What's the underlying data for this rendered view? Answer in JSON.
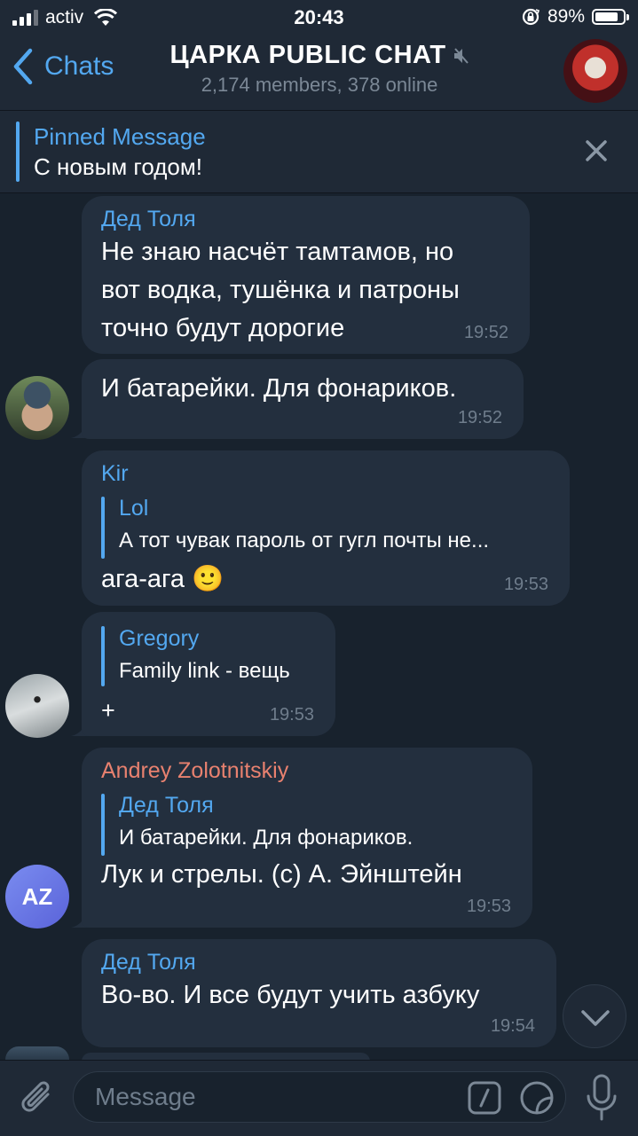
{
  "status_bar": {
    "carrier": "activ",
    "time": "20:43",
    "battery_text": "89%",
    "battery_level": 0.89
  },
  "header": {
    "back_label": "Chats",
    "title": "ЦАРКА PUBLIC CHAT",
    "subtitle": "2,174 members, 378 online",
    "muted": true
  },
  "pinned": {
    "title": "Pinned Message",
    "text": "С новым годом!"
  },
  "messages": [
    {
      "sender": "Дед Толя",
      "sender_color": "#53a8f0",
      "lines": [
        "Не знаю насчёт тамтамов, но",
        "вот водка, тушёнка и патроны",
        "точно будут дорогие"
      ],
      "time": "19:52"
    },
    {
      "lines": [
        "И батарейки. Для фонариков."
      ],
      "time": "19:52"
    },
    {
      "sender": "Kir",
      "sender_color": "#53a8f0",
      "reply": {
        "name": "Lol",
        "text": "А тот чувак пароль от гугл почты не..."
      },
      "lines": [
        "ага-ага 🙂"
      ],
      "time": "19:53"
    },
    {
      "reply": {
        "name": "Gregory",
        "text": "Family link - вещь"
      },
      "lines": [
        "+"
      ],
      "time": "19:53"
    },
    {
      "sender": "Andrey Zolotnitskiy",
      "sender_color": "#e8816f",
      "avatar_initials": "AZ",
      "reply": {
        "name": "Дед Толя",
        "text": "И батарейки. Для фонариков."
      },
      "lines": [
        "Лук и стрелы. (с) А. Эйнштейн"
      ],
      "time": "19:53"
    },
    {
      "sender": "Дед Толя",
      "sender_color": "#53a8f0",
      "lines": [
        "Во-во. И все будут учить азбуку"
      ],
      "time": "19:54"
    }
  ],
  "composer": {
    "placeholder": "Message"
  },
  "colors": {
    "accent": "#53a8f0",
    "background": "#18222d",
    "bubble": "#232f3e",
    "bar": "#1f2936"
  },
  "icons": [
    "back-chevron-icon",
    "muted-speaker-icon",
    "close-icon",
    "scroll-down-chevron-icon",
    "paperclip-icon",
    "bot-command-icon",
    "sticker-icon",
    "microphone-icon"
  ]
}
